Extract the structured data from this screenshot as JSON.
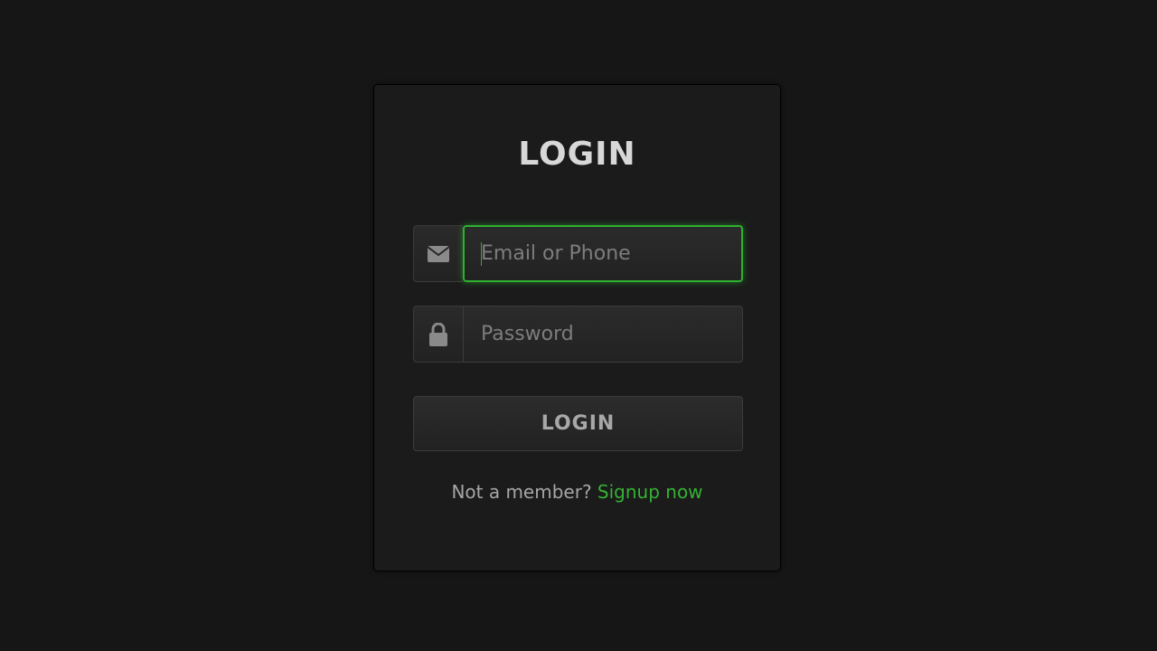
{
  "login_form": {
    "title": "LOGIN",
    "email_field": {
      "placeholder": "Email or Phone",
      "value": "",
      "icon": "envelope-icon",
      "focused": true
    },
    "password_field": {
      "placeholder": "Password",
      "value": "",
      "icon": "lock-icon"
    },
    "submit_label": "LOGIN",
    "signup_prompt": "Not a member?",
    "signup_link": "Signup now"
  },
  "colors": {
    "background": "#161616",
    "card": "#1b1b1b",
    "accent": "#35b235",
    "title_text": "#d8d8d8",
    "muted_text": "#a6a6a6"
  }
}
